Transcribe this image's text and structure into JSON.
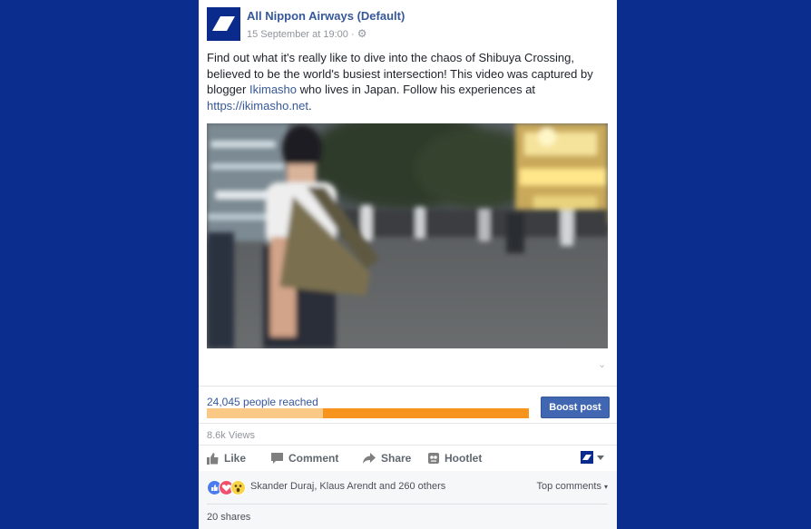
{
  "post": {
    "page_name": "All Nippon Airways (Default)",
    "timestamp": "15 September at 19:00",
    "separator": " · ",
    "text_before": "Find out what it's really like to dive into the chaos of Shibuya Crossing, believed to be the world's busiest intersection! This video was captured by blogger ",
    "mention": "Ikimasho",
    "text_middle": " who lives in Japan. Follow his experiences at ",
    "url": "https://ikimasho.net",
    "text_after": ".",
    "colors": {
      "brand_blue": "#0a2a8c",
      "link": "#365899",
      "background": "#0b2d8e"
    }
  },
  "video": {
    "scene": "street-video-frame"
  },
  "insights": {
    "reach_label": "24,045 people reached",
    "reach_bar_organic_fraction": 0.36,
    "boost_label": "Boost post",
    "views": "8.6k Views"
  },
  "actions": {
    "like": "Like",
    "comment": "Comment",
    "share": "Share",
    "hootlet": "Hootlet"
  },
  "reactions": {
    "icons": [
      "like-reaction-icon",
      "love-reaction-icon",
      "wow-reaction-icon"
    ],
    "names": "Skander Duraj, Klaus Arendt and 260 others",
    "top_comments": "Top comments"
  },
  "shares": {
    "label": "20 shares"
  }
}
